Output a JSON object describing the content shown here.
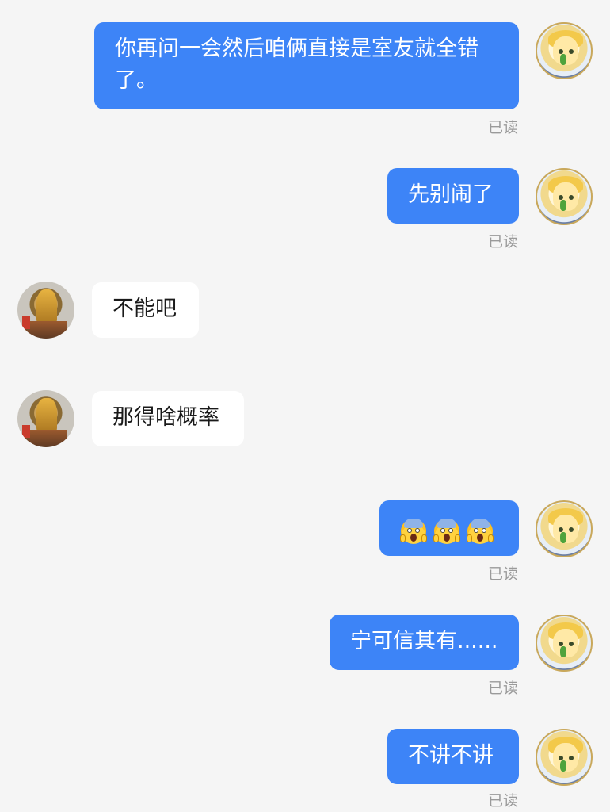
{
  "messages": [
    {
      "side": "sent",
      "text": "你再问一会然后咱俩直接是室友就全错了。",
      "status": "已读"
    },
    {
      "side": "sent",
      "text": "先别闹了",
      "status": "已读"
    },
    {
      "side": "received",
      "text": "不能吧"
    },
    {
      "side": "received",
      "text": "那得啥概率"
    },
    {
      "side": "sent",
      "text": "",
      "emoji": [
        "face-screaming-in-fear",
        "face-screaming-in-fear",
        "face-screaming-in-fear"
      ],
      "status": "已读"
    },
    {
      "side": "sent",
      "text": "宁可信其有......",
      "status": "已读"
    },
    {
      "side": "sent",
      "text": "不讲不讲",
      "status": "已读"
    }
  ],
  "colors": {
    "sent_bubble": "#3d84f7",
    "received_bubble": "#ffffff",
    "background": "#f5f5f5",
    "status_text": "#9a9a9a"
  }
}
